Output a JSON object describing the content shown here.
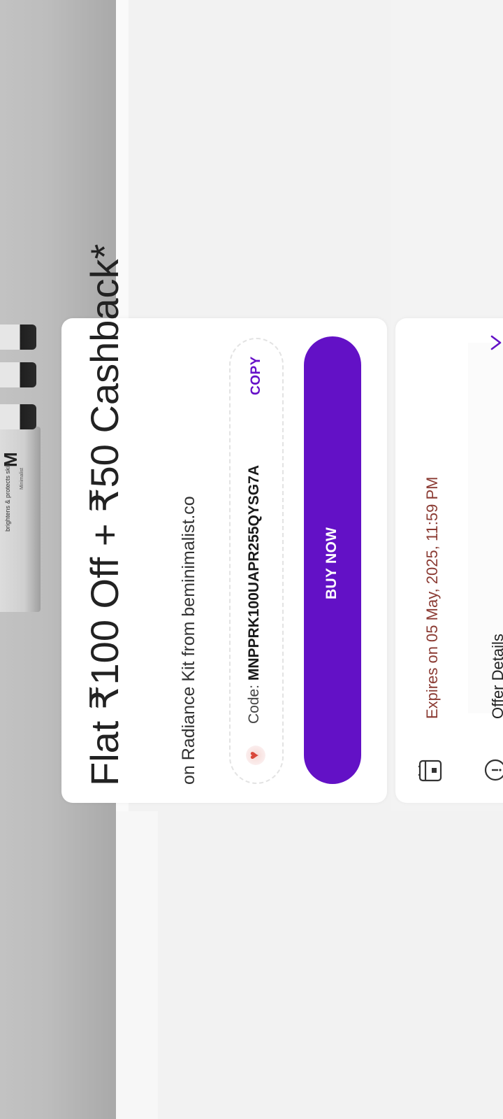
{
  "hero": {
    "product_tagline": "brightens & protects skin",
    "product_brand": "Minimalist",
    "product_logo": "M"
  },
  "offer": {
    "title": "Flat ₹100 Off + ₹50 Cashback*",
    "subtitle": "on Radiance Kit from beminimalist.co",
    "code_prefix": "Code: ",
    "code": "MNPPRK100UAPR255QYSG7A",
    "copy_label": "COPY",
    "buy_label": "BUY NOW",
    "accent_color": "#6311c6"
  },
  "details": {
    "expires": "Expires on 05 May, 2025, 11:59 PM",
    "offer_details_label": "Offer Details",
    "expiry_icon": "calendar-icon",
    "info_icon": "info-icon",
    "chevron_icon": "chevron-right-icon"
  }
}
